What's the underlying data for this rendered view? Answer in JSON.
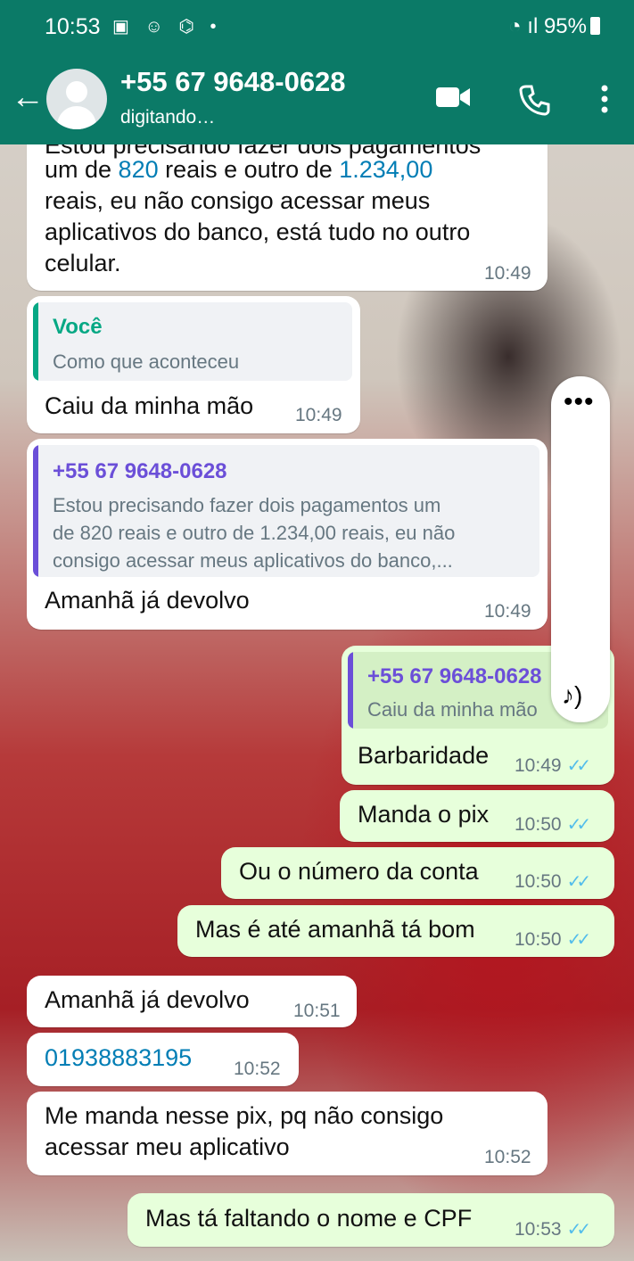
{
  "status_bar": {
    "time": "10:53",
    "icons": "▣ ☺ ⌬ •",
    "battery": "95%"
  },
  "header": {
    "back_icon": "←",
    "title": "+55 67 9648-0628",
    "subtitle": "digitando…"
  },
  "messages": {
    "m1": {
      "line0": "Estou precisando fazer dois pagamentos",
      "line1a": "um de ",
      "line1b": "820",
      "line1c": " reais e outro de ",
      "line1d": "1.234,00",
      "line2": "reais, eu não consigo acessar meus",
      "line3": "aplicativos do banco, está tudo no outro",
      "line4": "celular.",
      "time": "10:49"
    },
    "m2": {
      "quote_name": "Você",
      "quote_text": "Como que aconteceu",
      "text": "Caiu da minha mão",
      "time": "10:49"
    },
    "m3": {
      "quote_name": "+55 67 9648-0628",
      "quote_l1": "Estou precisando fazer dois pagamentos um",
      "quote_l2": "de 820 reais e outro de 1.234,00 reais, eu não",
      "quote_l3": "consigo acessar meus aplicativos do banco,...",
      "text": "Amanhã já devolvo",
      "time": "10:49"
    },
    "m4": {
      "quote_name": "+55 67 9648-0628",
      "quote_text": "Caiu da minha mão",
      "text": "Barbaridade",
      "time": "10:49"
    },
    "m5": {
      "text": "Manda o pix",
      "time": "10:50"
    },
    "m6": {
      "text": "Ou o número da conta",
      "time": "10:50"
    },
    "m7": {
      "text": "Mas é até amanhã tá bom",
      "time": "10:50"
    },
    "m8": {
      "text": "Amanhã já devolvo",
      "time": "10:51"
    },
    "m9": {
      "text": "01938883195",
      "time": "10:52"
    },
    "m10": {
      "line1": "Me manda nesse pix, pq não consigo",
      "line2": "acessar meu aplicativo",
      "time": "10:52"
    },
    "m11": {
      "text": "Mas tá faltando o nome e CPF",
      "time": "10:53"
    }
  },
  "colors": {
    "header": "#0b7a67",
    "outgoing": "#e7ffdb",
    "you_quote": "#06a884",
    "contact_quote": "#6b4fd8",
    "ticks": "#53bdeb"
  }
}
